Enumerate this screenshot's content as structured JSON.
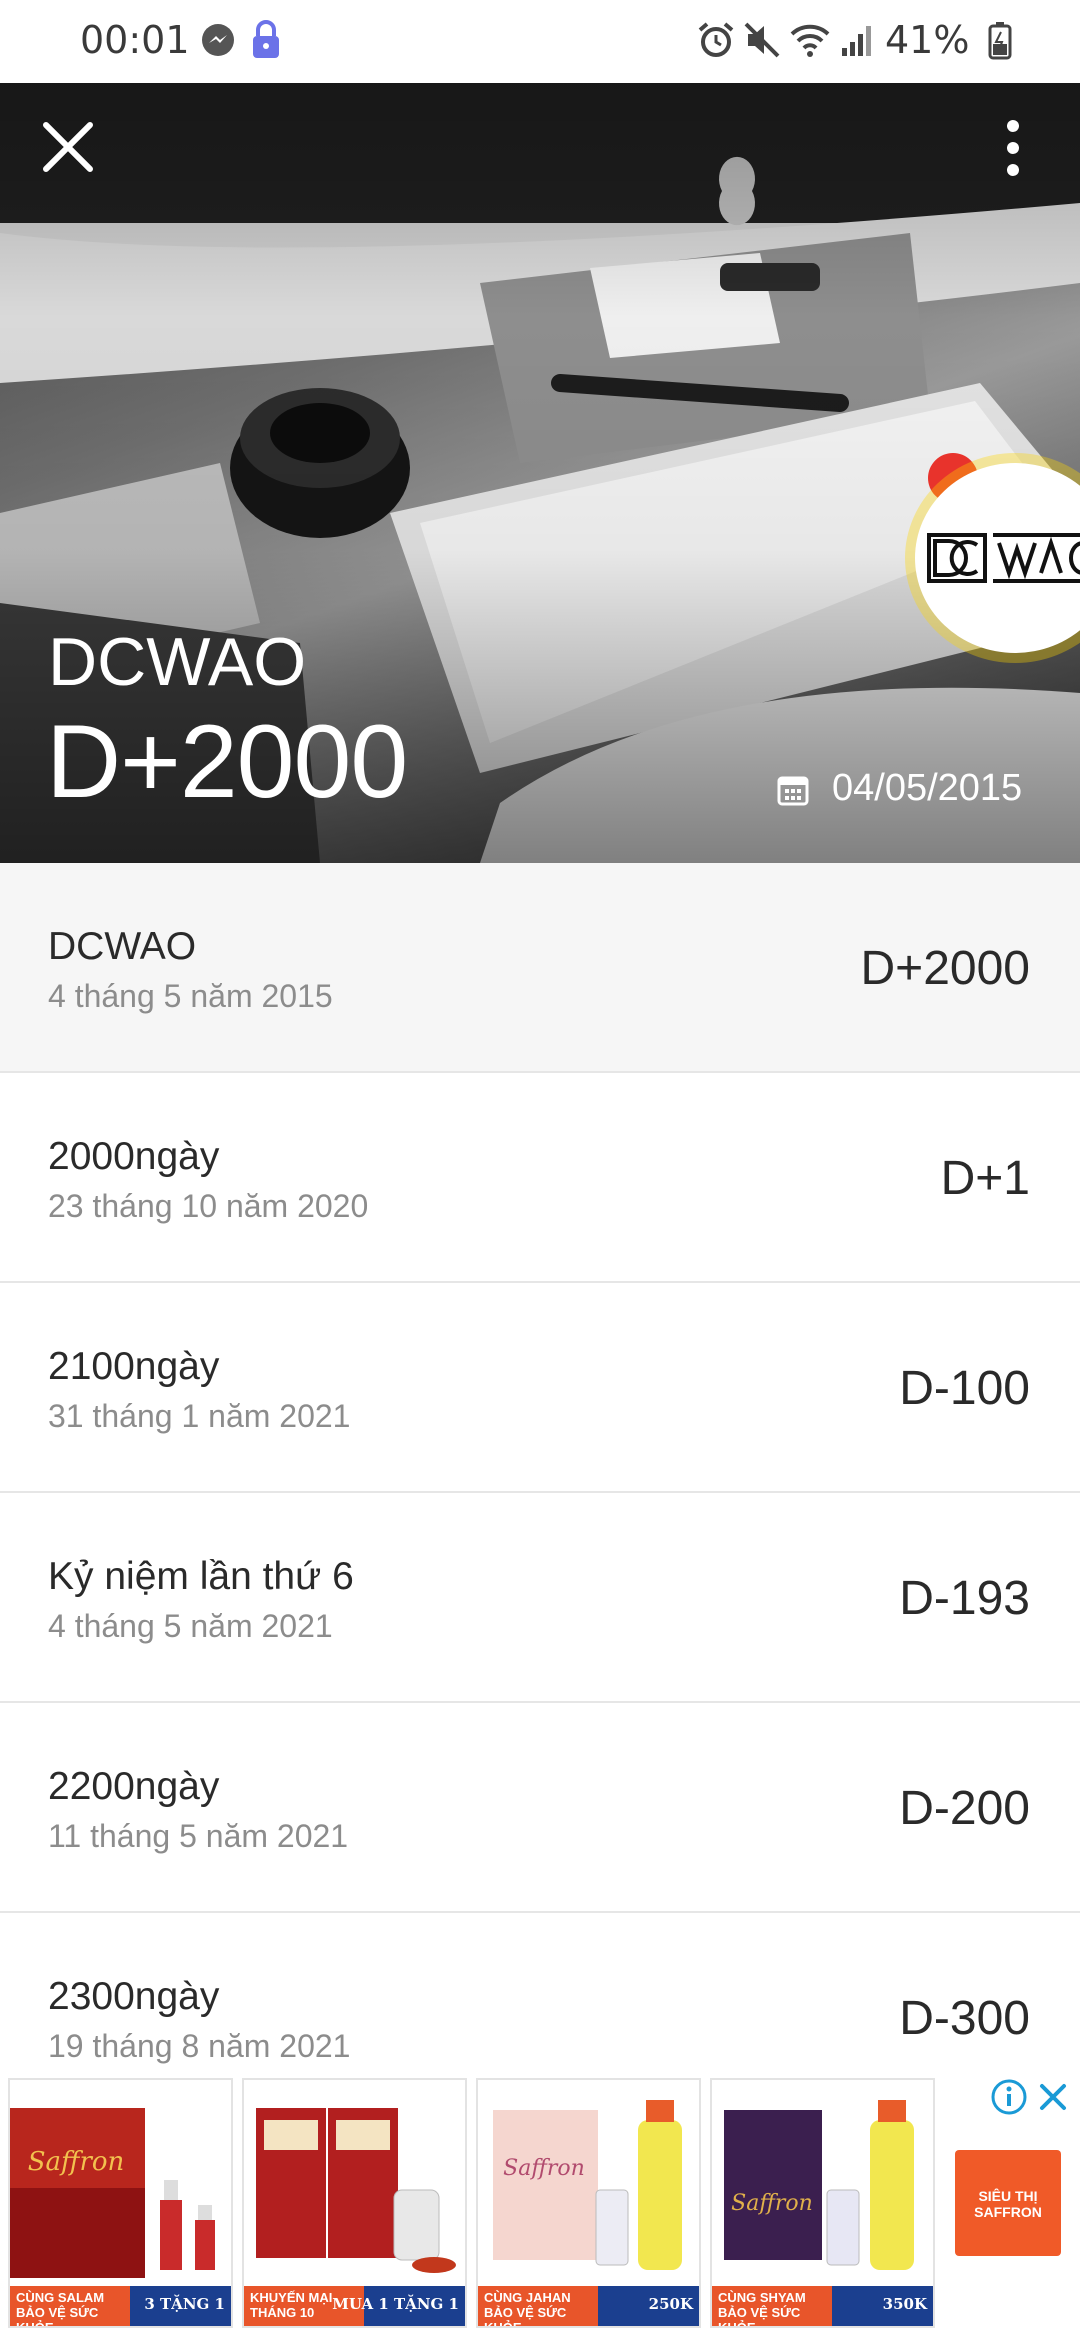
{
  "status_bar": {
    "time": "00:01",
    "battery_pct": "41%"
  },
  "hero": {
    "name": "DCWAO",
    "d_count": "D+2000",
    "date": "04/05/2015"
  },
  "events": [
    {
      "title": "DCWAO",
      "date": "4 tháng 5 năm 2015",
      "d": "D+2000",
      "highlighted": true
    },
    {
      "title": "2000ngày",
      "date": "23 tháng 10 năm 2020",
      "d": "D+1"
    },
    {
      "title": "2100ngày",
      "date": "31 tháng 1 năm 2021",
      "d": "D-100"
    },
    {
      "title": "Kỷ niệm lần thứ 6",
      "date": "4 tháng 5 năm 2021",
      "d": "D-193"
    },
    {
      "title": "2200ngày",
      "date": "11 tháng 5 năm 2021",
      "d": "D-200"
    },
    {
      "title": "2300ngày",
      "date": "19 tháng 8 năm 2021",
      "d": "D-300"
    }
  ],
  "ad": {
    "cards": [
      {
        "caption_left": "CÙNG SALAM BẢO VỆ SỨC KHỎE",
        "caption_right": "3 TẶNG 1"
      },
      {
        "caption_left": "KHUYẾN MẠI THÁNG 10",
        "caption_right": "MUA 1 TẶNG 1"
      },
      {
        "caption_left": "CÙNG JAHAN BẢO VỆ SỨC KHỎE",
        "caption_right": "250K"
      },
      {
        "caption_left": "CÙNG SHYAM BẢO VỆ SỨC KHỎE",
        "caption_right": "350K"
      }
    ],
    "brand": "SIÊU THỊ SAFFRON"
  }
}
